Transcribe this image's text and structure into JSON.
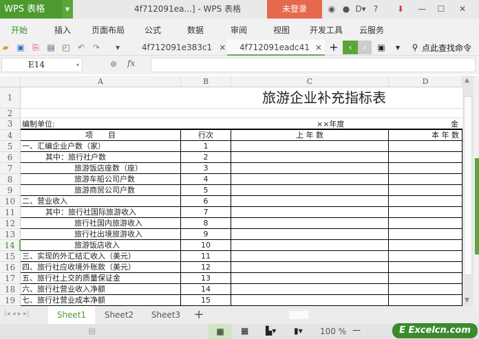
{
  "titlebar": {
    "app_name": "WPS 表格",
    "window_title": "4f712091ea...] - WPS 表格",
    "login_label": "未登录",
    "help": "?"
  },
  "menu": [
    "开始",
    "插入",
    "页面布局",
    "公式",
    "数据",
    "审阅",
    "视图",
    "开发工具",
    "云服务"
  ],
  "doc_tabs": [
    {
      "label": "4f712091e383c1"
    },
    {
      "label": "4f712091eadc41",
      "active": true
    }
  ],
  "search_command": "点此查找命令",
  "formula_bar": {
    "cell_ref": "E14",
    "fx": "fx",
    "value": ""
  },
  "columns": [
    "A",
    "B",
    "C",
    "D"
  ],
  "sheet": {
    "title": "旅游企业补充指标表",
    "unit_label": "编制单位:",
    "year_label": "××年度",
    "amount_label": "金",
    "headers": [
      "项　　目",
      "行次",
      "上 年 数",
      "本 年 数"
    ],
    "rows": [
      {
        "num": "5",
        "item": "一、汇编企业户数（家）",
        "line": "1",
        "indent": 0
      },
      {
        "num": "6",
        "item": "其中：旅行社户数",
        "line": "2",
        "indent": 1
      },
      {
        "num": "7",
        "item": "旅游饭店座数（座）",
        "line": "3",
        "indent": 2
      },
      {
        "num": "8",
        "item": "旅游车船公司户数",
        "line": "4",
        "indent": 2
      },
      {
        "num": "9",
        "item": "旅游商贸公司户数",
        "line": "5",
        "indent": 2
      },
      {
        "num": "10",
        "item": "二、营业收入",
        "line": "6",
        "indent": 0
      },
      {
        "num": "11",
        "item": "其中：旅行社国际旅游收入",
        "line": "7",
        "indent": 1
      },
      {
        "num": "12",
        "item": "旅行社国内旅游收入",
        "line": "8",
        "indent": 2
      },
      {
        "num": "13",
        "item": "旅行社出境旅游收入",
        "line": "9",
        "indent": 2
      },
      {
        "num": "14",
        "item": "旅游饭店收入",
        "line": "10",
        "indent": 2
      },
      {
        "num": "15",
        "item": "三、实现的外汇结汇收入（美元）",
        "line": "11",
        "indent": 0
      },
      {
        "num": "16",
        "item": "四、旅行社应收境外账款（美元）",
        "line": "12",
        "indent": 0
      },
      {
        "num": "17",
        "item": "五、旅行社上交的质量保证金",
        "line": "13",
        "indent": 0
      },
      {
        "num": "18",
        "item": "六、旅行社营业收入净额",
        "line": "14",
        "indent": 0
      },
      {
        "num": "19",
        "item": "七、旅行社营业成本净额",
        "line": "15",
        "indent": 0
      }
    ]
  },
  "row_numbers_top": [
    "1",
    "2",
    "3",
    "4"
  ],
  "sheets": [
    "Sheet1",
    "Sheet2",
    "Sheet3"
  ],
  "add_sheet": "+",
  "status": {
    "zoom": "100 %"
  },
  "watermark": "Excelcn.com",
  "colors": {
    "accent": "#4d9a2f",
    "login": "#e5694d"
  }
}
